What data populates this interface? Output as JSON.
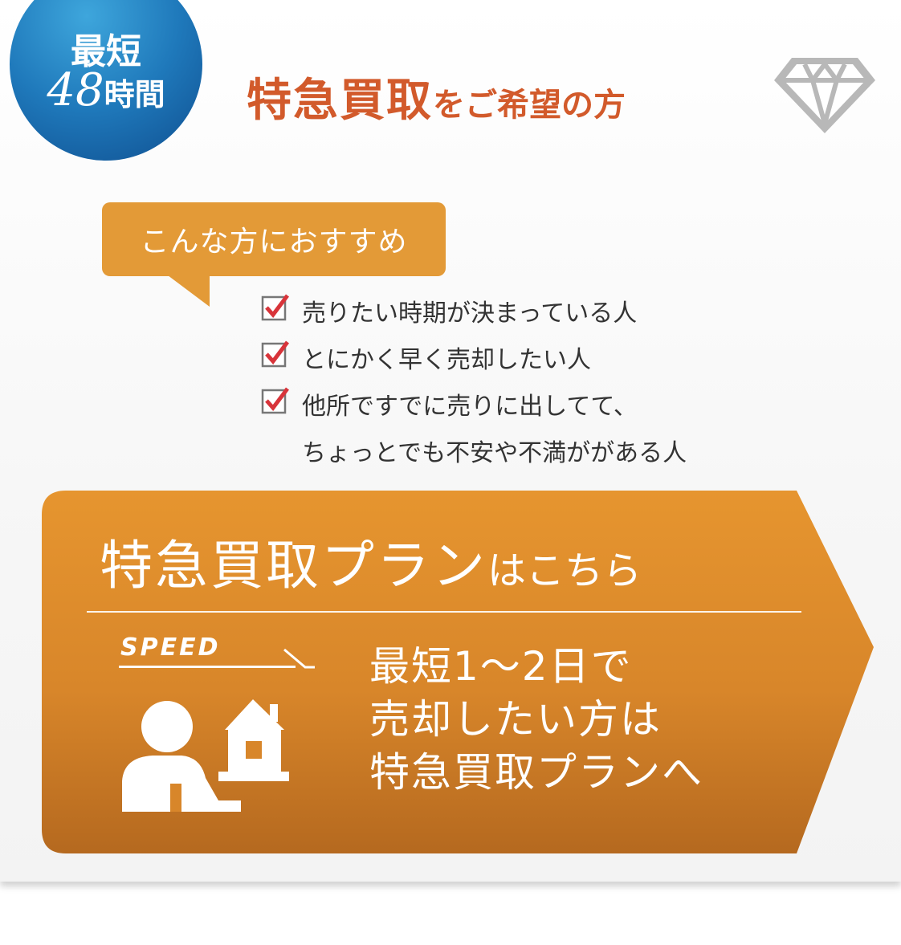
{
  "badge": {
    "line1": "最短",
    "number": "48",
    "unit": "時間"
  },
  "header": {
    "title_main": "特急買取",
    "title_suffix": "をご希望の方"
  },
  "colors": {
    "accent_blue": "#1f79bb",
    "accent_red": "#d25a2b",
    "accent_orange": "#e39a37",
    "check_red": "#d8343a"
  },
  "bubble": {
    "label": "こんな方におすすめ"
  },
  "checklist": {
    "items": [
      "売りたい時期が決まっている人",
      "とにかく早く売却したい人",
      "他所ですでに売りに出してて、"
    ],
    "continuation": "ちょっとでも不安や不満ががある人"
  },
  "cta": {
    "title_main": "特急買取プラン",
    "title_suffix": "はこちら",
    "speed_label": "SPEED",
    "desc_line1": "最短1～2日で",
    "desc_line2": "売却したい方は",
    "desc_line3": "特急買取プランへ"
  },
  "icons": [
    "diamond-icon",
    "checkbox-icon",
    "person-holding-house-icon",
    "speed-icon"
  ]
}
